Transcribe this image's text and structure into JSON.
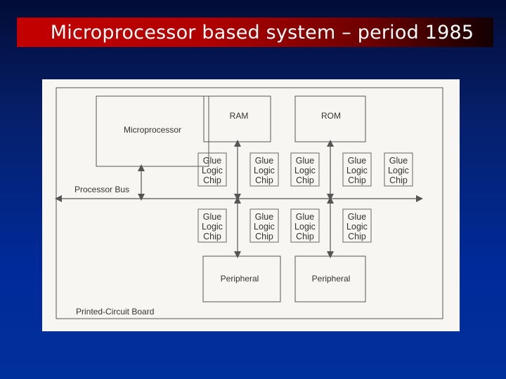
{
  "slide": {
    "title": "Microprocessor based system – period 1985"
  },
  "diagram": {
    "board_label": "Printed-Circuit Board",
    "bus_label": "Processor Bus",
    "microprocessor_label": "Microprocessor",
    "ram_label": "RAM",
    "rom_label": "ROM",
    "peripherals": [
      "Peripheral",
      "Peripheral"
    ],
    "glue_chip_lines": [
      "Glue",
      "Logic",
      "Chip"
    ],
    "glue_chip_count_top": 5,
    "glue_chip_count_bottom": 4
  },
  "colors": {
    "title_bar": "#c30000",
    "background": "#002a99",
    "figure_bg": "#f7f6f2",
    "line": "#555555"
  }
}
